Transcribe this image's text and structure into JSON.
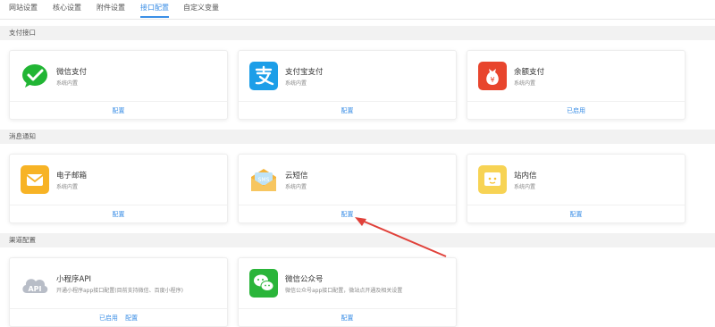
{
  "tabs": [
    "网站设置",
    "核心设置",
    "附件设置",
    "接口配置",
    "自定义变量"
  ],
  "sections": {
    "payment": "支付接口",
    "notify": "消息通知",
    "channel": "渠道配置"
  },
  "cards": {
    "wechat_pay": {
      "title": "微信支付",
      "desc": "系统内置",
      "action": "配置"
    },
    "alipay": {
      "title": "支付宝支付",
      "desc": "系统内置",
      "action": "配置"
    },
    "balance_pay": {
      "title": "余额支付",
      "desc": "系统内置",
      "action": "已启用"
    },
    "email": {
      "title": "电子邮箱",
      "desc": "系统内置",
      "action": "配置"
    },
    "sms": {
      "title": "云短信",
      "desc": "系统内置",
      "action": "配置"
    },
    "site_msg": {
      "title": "站内信",
      "desc": "系统内置",
      "action": "配置"
    },
    "miniapp": {
      "title": "小程序API",
      "desc": "开通小程序app接口配置(目前支持微信、百度小程序)",
      "action_enabled": "已启用",
      "action": "配置"
    },
    "wechat_mp": {
      "title": "微信公众号",
      "desc": "微信公众号app接口配置，微站点开通及相关设置",
      "action": "配置"
    }
  },
  "icons": {
    "wechat_pay": "wechat-pay-icon",
    "alipay": "alipay-icon",
    "balance_pay": "money-bag-icon",
    "email": "envelope-icon",
    "sms": "sms-icon",
    "site_msg": "message-box-icon",
    "miniapp": "api-cloud-icon",
    "wechat_mp": "wechat-icon"
  },
  "colors": {
    "accent": "#3a8ee6",
    "wechat": "#21b534",
    "alipay": "#1c9ee8",
    "balance": "#e8452d",
    "email": "#f7b325",
    "site_msg": "#f7d354",
    "miniapp": "#b8bdc7",
    "wechat_mp": "#2ab53a",
    "annotation_arrow": "#e0413a"
  }
}
